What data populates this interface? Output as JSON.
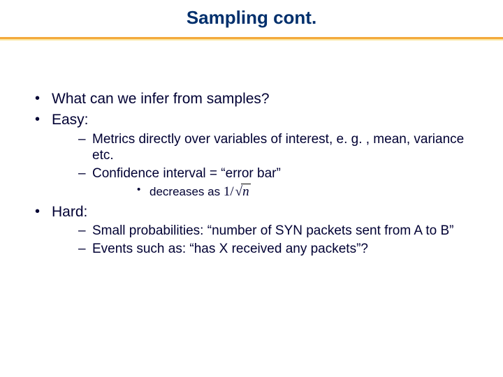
{
  "title": "Sampling cont.",
  "bullets": {
    "b1": "What can we infer from samples?",
    "b2": "Easy:",
    "b2_1": "Metrics directly over variables of interest, e. g. , mean, variance etc.",
    "b2_2": "Confidence interval = “error bar”",
    "b2_2_1_prefix": "decreases as  ",
    "b3": "Hard:",
    "b3_1": "Small probabilities: “number of SYN packets sent from A to B”",
    "b3_2": "Events such as: “has X received any packets”?"
  },
  "formula": {
    "text": "1/√n",
    "numerator": "1",
    "radicand": "n"
  }
}
